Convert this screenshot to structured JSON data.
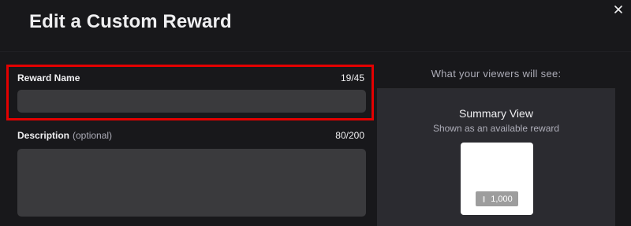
{
  "modal": {
    "title": "Edit a Custom Reward",
    "close_icon": "close-icon"
  },
  "form": {
    "reward_name": {
      "label": "Reward Name",
      "counter": "19/45",
      "value": "",
      "highlight_color": "#e30000"
    },
    "description": {
      "label": "Description",
      "optional_label": "(optional)",
      "counter": "80/200",
      "value": ""
    }
  },
  "preview": {
    "heading": "What your viewers will see:",
    "summary_title": "Summary View",
    "summary_subtitle": "Shown as an available reward",
    "card": {
      "background": "#ffffff",
      "cost_icon": "channel-points-icon",
      "cost": "1,000"
    }
  },
  "colors": {
    "background": "#18181b",
    "input_background": "#3a3a3d",
    "preview_background": "#2b2b30",
    "text_primary": "#efeff1",
    "text_secondary": "#adadb8"
  }
}
